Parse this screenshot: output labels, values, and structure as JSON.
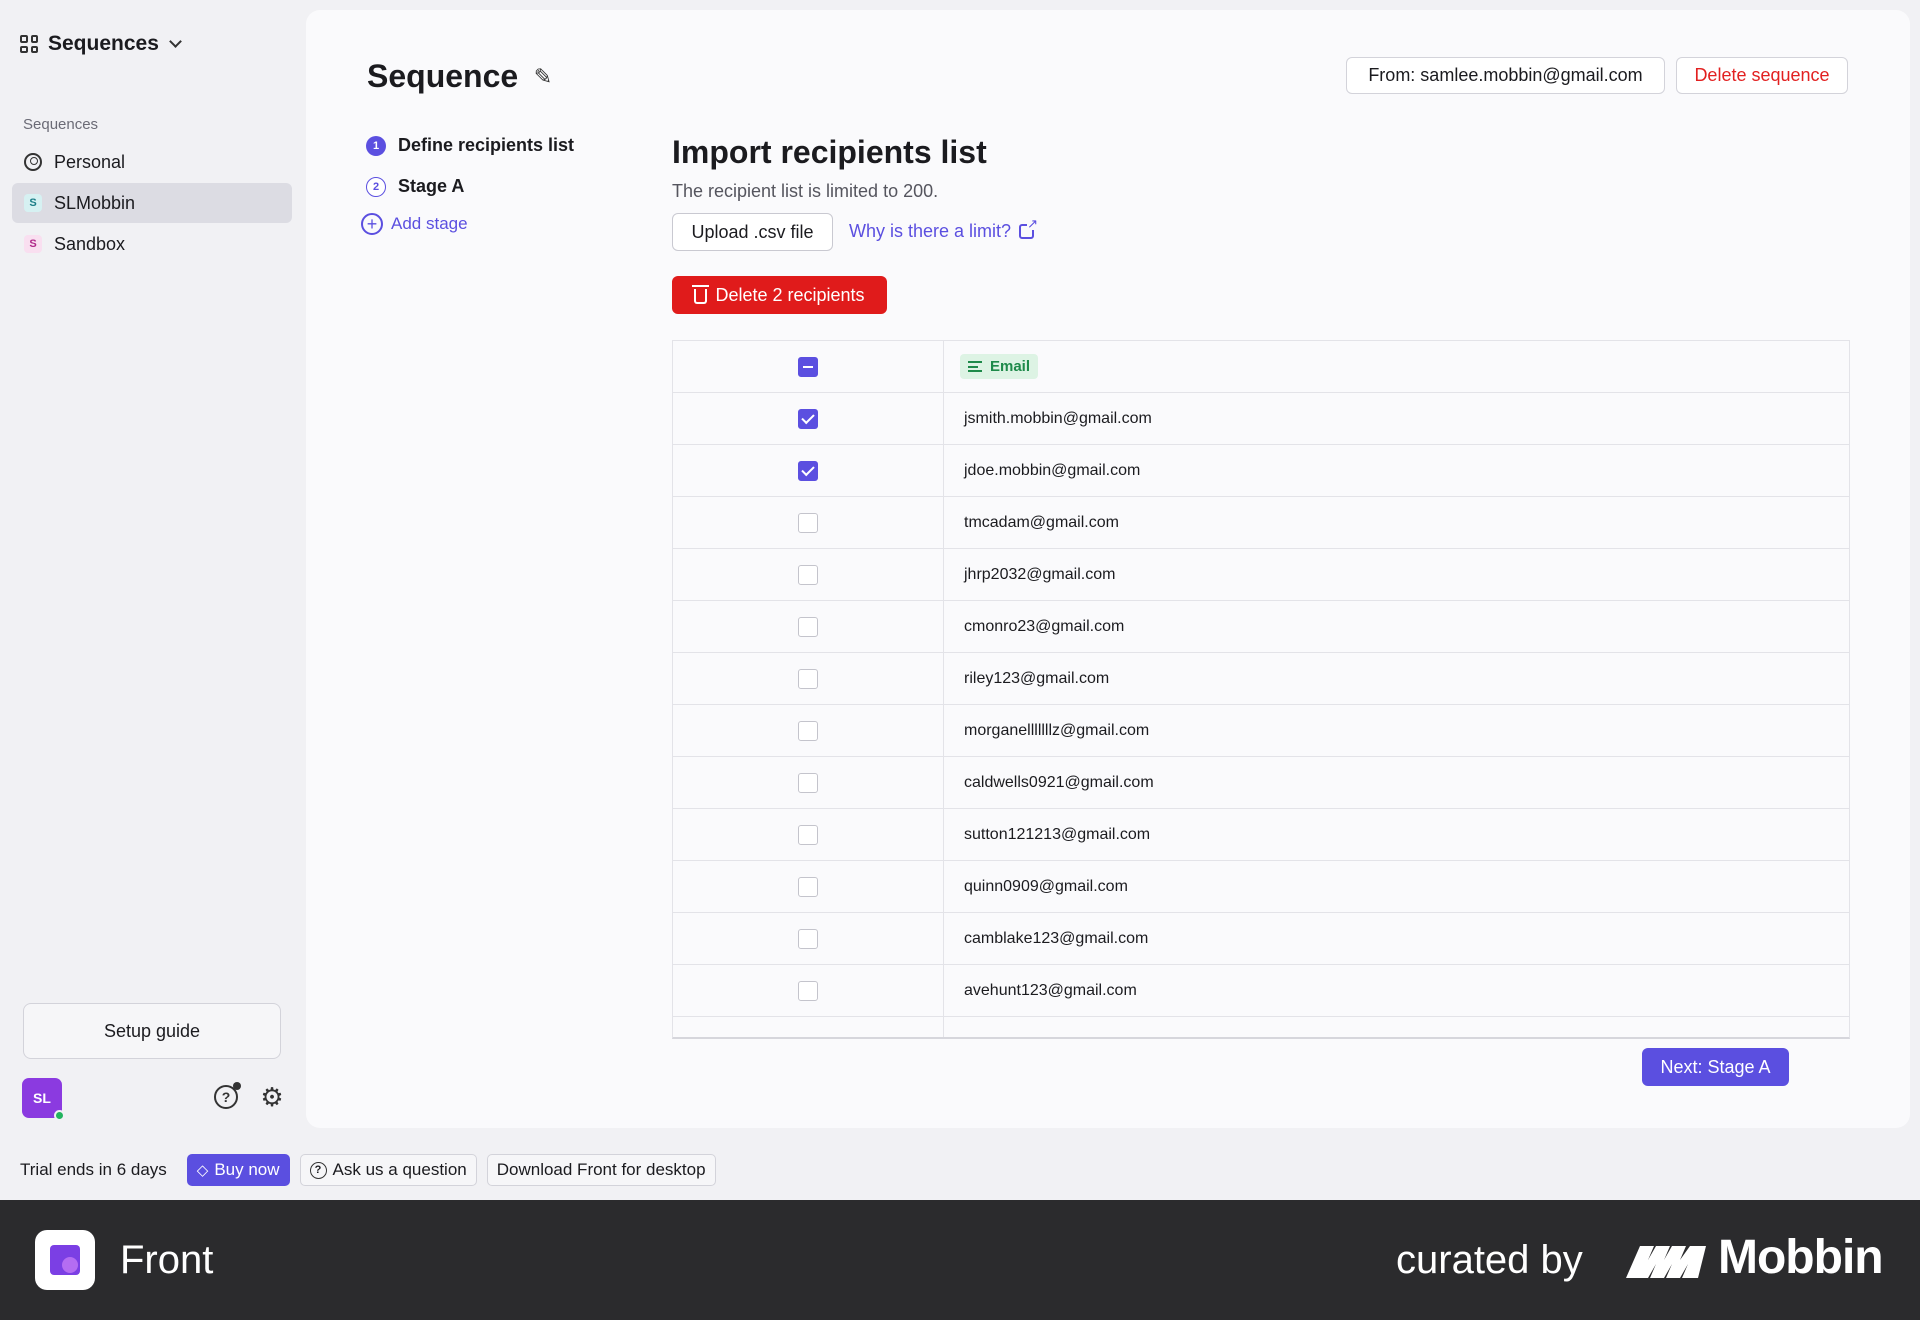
{
  "sidebar": {
    "workspace_title": "Sequences",
    "section_label": "Sequences",
    "items": [
      {
        "label": "Personal",
        "badge": ""
      },
      {
        "label": "SLMobbin",
        "badge": "S"
      },
      {
        "label": "Sandbox",
        "badge": "S"
      }
    ],
    "active_item": "SLMobbin",
    "setup_guide_label": "Setup guide",
    "avatar_initials": "SL"
  },
  "header": {
    "title": "Sequence",
    "from_label": "From: samlee.mobbin@gmail.com",
    "delete_sequence_label": "Delete sequence"
  },
  "steps": [
    {
      "number": "1",
      "label": "Define recipients list",
      "state": "current"
    },
    {
      "number": "2",
      "label": "Stage A",
      "state": "upcoming"
    }
  ],
  "add_stage_label": "Add stage",
  "import": {
    "title": "Import recipients list",
    "subtitle": "The recipient list is limited to 200.",
    "upload_label": "Upload .csv file",
    "why_label": "Why is there a limit?",
    "delete_label": "Delete 2 recipients"
  },
  "table": {
    "column_header": "Email",
    "header_checkbox_state": "indeterminate",
    "rows": [
      {
        "email": "jsmith.mobbin@gmail.com",
        "checked": true
      },
      {
        "email": "jdoe.mobbin@gmail.com",
        "checked": true
      },
      {
        "email": "tmcadam@gmail.com",
        "checked": false
      },
      {
        "email": "jhrp2032@gmail.com",
        "checked": false
      },
      {
        "email": "cmonro23@gmail.com",
        "checked": false
      },
      {
        "email": "riley123@gmail.com",
        "checked": false
      },
      {
        "email": "morganelllllllz@gmail.com",
        "checked": false
      },
      {
        "email": "caldwells0921@gmail.com",
        "checked": false
      },
      {
        "email": "sutton121213@gmail.com",
        "checked": false
      },
      {
        "email": "quinn0909@gmail.com",
        "checked": false
      },
      {
        "email": "camblake123@gmail.com",
        "checked": false
      },
      {
        "email": "avehunt123@gmail.com",
        "checked": false
      },
      {
        "email": "",
        "checked": false
      }
    ]
  },
  "next_label": "Next: Stage A",
  "trial_bar": {
    "trial_text": "Trial ends in 6 days",
    "buy_label": "Buy now",
    "ask_label": "Ask us a question",
    "download_label": "Download Front for desktop"
  },
  "footer": {
    "app_name": "Front",
    "curated_text": "curated by",
    "brand_name": "Mobbin"
  },
  "colors": {
    "accent": "#5b4fe0",
    "danger": "#e01b1b",
    "email_tag_bg": "#ddf3e4",
    "email_tag_text": "#1e8a4a"
  }
}
